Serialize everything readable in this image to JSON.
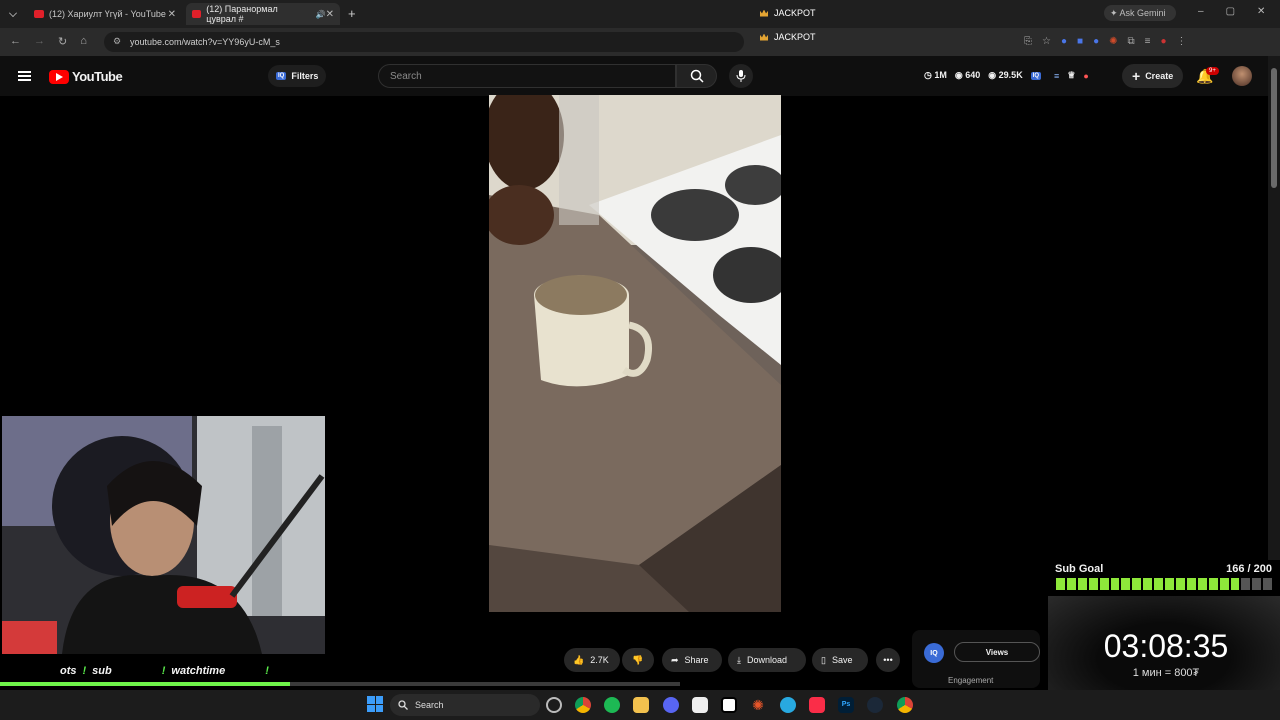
{
  "browser": {
    "tabs": [
      {
        "title": "(12) Хариулт Үгүй - YouTube"
      },
      {
        "title": "(12) Паранормал цуврал #"
      }
    ],
    "url": "youtube.com/watch?v=YY96yU-cM_s",
    "bookmarks": [
      "JACKPOT",
      "JACKPOT"
    ],
    "gemini_label": "Ask Gemini"
  },
  "youtube": {
    "brand": "YouTube",
    "filters_label": "Filters",
    "iq_badge": "IQ",
    "search_placeholder": "Search",
    "stats": {
      "views": "1M",
      "likes": "640",
      "subs": "29.5K"
    },
    "create_label": "Create",
    "notif_badge": "9+"
  },
  "actions": {
    "like_count": "2.7K",
    "share_label": "Share",
    "download_label": "Download",
    "save_label": "Save"
  },
  "iq_panel": {
    "views_tab": "Views",
    "engagement_label": "Engagement"
  },
  "stream_overlay": {
    "alert_items": [
      "ots",
      "sub",
      "watchtime"
    ],
    "sub_goal_label": "Sub Goal",
    "sub_goal_progress": "166 / 200",
    "sub_goal_fraction": 0.83,
    "timer": "03:08:35",
    "rate": "1 мин = 800₮"
  },
  "taskbar": {
    "search_label": "Search"
  },
  "colors": {
    "yt_red": "#ff0000",
    "goal_green": "#8ee83a",
    "accent_yellow": "#f7e21a"
  }
}
